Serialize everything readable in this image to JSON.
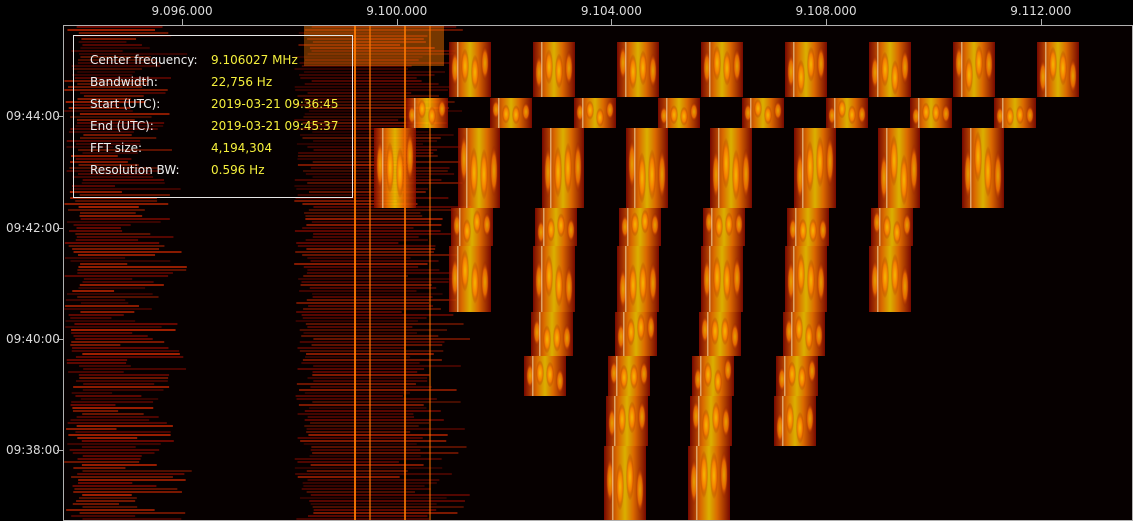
{
  "chart_data": {
    "type": "heatmap",
    "title": "",
    "xlabel": "",
    "ylabel": "",
    "x_axis": {
      "range": [
        9.0938,
        9.1137
      ],
      "unit": "MHz",
      "ticks": [
        "9.096.000",
        "9.100.000",
        "9.104.000",
        "9.108.000",
        "9.112.000"
      ],
      "tick_values": [
        9.096,
        9.1,
        9.104,
        9.108,
        9.112
      ]
    },
    "y_axis": {
      "range": [
        "09:36:45",
        "09:45:37"
      ],
      "direction": "time increases upward",
      "ticks": [
        "09:44:00",
        "09:42:00",
        "09:40:00",
        "09:38:00"
      ],
      "tick_minutes": [
        584,
        582,
        580,
        578
      ]
    },
    "colormap": [
      "#000000",
      "#3a0000",
      "#8a0a00",
      "#d82a00",
      "#ff7a00",
      "#ffd000",
      "#fffbd0"
    ],
    "info": {
      "rows": [
        {
          "label": "Center frequency:",
          "value": "9.106027 MHz"
        },
        {
          "label": "Bandwidth:",
          "value": "22,756 Hz"
        },
        {
          "label": "Start (UTC):",
          "value": "2019-03-21 09:36:45"
        },
        {
          "label": "End (UTC):",
          "value": "2019-03-21 09:45:37"
        },
        {
          "label": "FFT size:",
          "value": "4,194,304"
        },
        {
          "label": "Resolution BW:",
          "value": "0.596 Hz"
        }
      ]
    },
    "grid": false,
    "legend": "none"
  }
}
